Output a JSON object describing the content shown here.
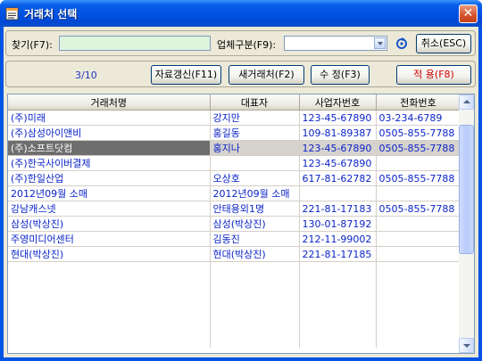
{
  "window": {
    "title": "거래처 선택",
    "close_symbol": "✕"
  },
  "search": {
    "find_label": "찾기(F7):",
    "find_value": "",
    "type_label": "업체구분(F9):",
    "type_value": "",
    "cancel_label": "취소(ESC)"
  },
  "toolbar": {
    "counter": "3/10",
    "refresh_label": "자료갱신(F11)",
    "new_label": "새거래처(F2)",
    "edit_label": "수 정(F3)",
    "apply_label": "적 용(F8)"
  },
  "table": {
    "columns": [
      "거래처명",
      "대표자",
      "사업자번호",
      "전화번호"
    ],
    "rows": [
      [
        "(주)미래",
        "강지만",
        "123-45-67890",
        "03-234-6789"
      ],
      [
        "(주)삼성아이앤비",
        "홍길동",
        "109-81-89387",
        "0505-855-7788"
      ],
      [
        "(주)소프트닷컴",
        "홍지나",
        "123-45-67890",
        "0505-855-7788"
      ],
      [
        "(주)한국사이버결제",
        "",
        "123-45-67890",
        ""
      ],
      [
        "(주)한일산업",
        "오상호",
        "617-81-62782",
        "0505-855-7788"
      ],
      [
        "2012년09월 소매",
        "2012년09월 소매",
        "",
        ""
      ],
      [
        "강남캐스넷",
        "안태용외1명",
        "221-81-17183",
        "0505-855-7788"
      ],
      [
        "삼성(박상진)",
        "삼성(박상진)",
        "130-01-87192",
        ""
      ],
      [
        "주영미디어센터",
        "김동진",
        "212-11-99002",
        ""
      ],
      [
        "현대(박상진)",
        "현대(박상진)",
        "221-81-17185",
        ""
      ]
    ],
    "selected_index": 2
  },
  "colors": {
    "titlebar": "#0054e3",
    "panel_bg": "#ece9d8",
    "cell_text": "#0b24c8",
    "selected_cell": "#6e6e6e",
    "apply_text": "#cc0000",
    "find_input_bg": "#dff4dd"
  },
  "icons": {
    "app": "window-list-icon",
    "refresh": "refresh-icon",
    "close": "close-icon"
  }
}
